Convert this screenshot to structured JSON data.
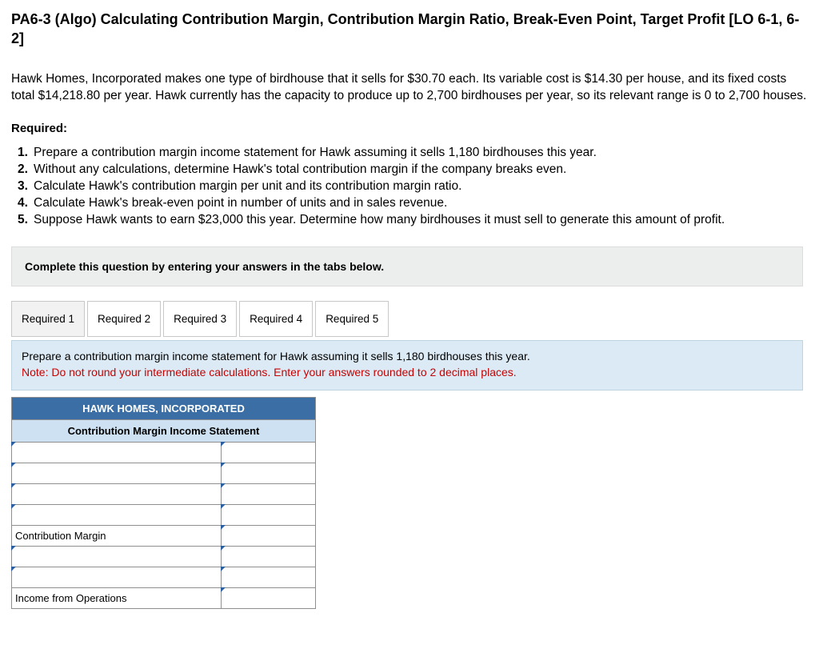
{
  "title": "PA6-3 (Algo) Calculating Contribution Margin, Contribution Margin Ratio, Break-Even Point, Target Profit [LO 6-1, 6-2]",
  "intro": "Hawk Homes, Incorporated makes one type of birdhouse that it sells for $30.70 each. Its variable cost is $14.30 per house, and its fixed costs total $14,218.80 per year. Hawk currently has the capacity to produce up to 2,700 birdhouses per year, so its relevant range is 0 to 2,700 houses.",
  "required_label": "Required:",
  "requirements": [
    {
      "num": "1.",
      "text": "Prepare a contribution margin income statement for Hawk assuming it sells 1,180 birdhouses this year."
    },
    {
      "num": "2.",
      "text": "Without any calculations, determine Hawk's total contribution margin if the company breaks even."
    },
    {
      "num": "3.",
      "text": "Calculate Hawk's contribution margin per unit and its contribution margin ratio."
    },
    {
      "num": "4.",
      "text": "Calculate Hawk's break-even point in number of units and in sales revenue."
    },
    {
      "num": "5.",
      "text": "Suppose Hawk wants to earn $23,000 this year. Determine how many birdhouses it must sell to generate this amount of profit."
    }
  ],
  "instruction_bar": "Complete this question by entering your answers in the tabs below.",
  "tabs": [
    "Required 1",
    "Required 2",
    "Required 3",
    "Required 4",
    "Required 5"
  ],
  "active_tab": 0,
  "tab_content": {
    "line1": "Prepare a contribution margin income statement for Hawk assuming it sells 1,180 birdhouses this year.",
    "line2": "Note: Do not round your intermediate calculations. Enter your answers rounded to 2 decimal places."
  },
  "statement": {
    "header1": "HAWK HOMES, INCORPORATED",
    "header2": "Contribution Margin Income Statement",
    "rows": [
      {
        "label": "",
        "value": "",
        "label_editable": true,
        "value_editable": true
      },
      {
        "label": "",
        "value": "",
        "label_editable": true,
        "value_editable": true
      },
      {
        "label": "",
        "value": "",
        "label_editable": true,
        "value_editable": true
      },
      {
        "label": "",
        "value": "",
        "label_editable": true,
        "value_editable": true
      },
      {
        "label": "Contribution Margin",
        "value": "",
        "label_editable": false,
        "value_editable": true
      },
      {
        "label": "",
        "value": "",
        "label_editable": true,
        "value_editable": true
      },
      {
        "label": "",
        "value": "",
        "label_editable": true,
        "value_editable": true
      },
      {
        "label": "Income from Operations",
        "value": "",
        "label_editable": false,
        "value_editable": true
      }
    ]
  }
}
